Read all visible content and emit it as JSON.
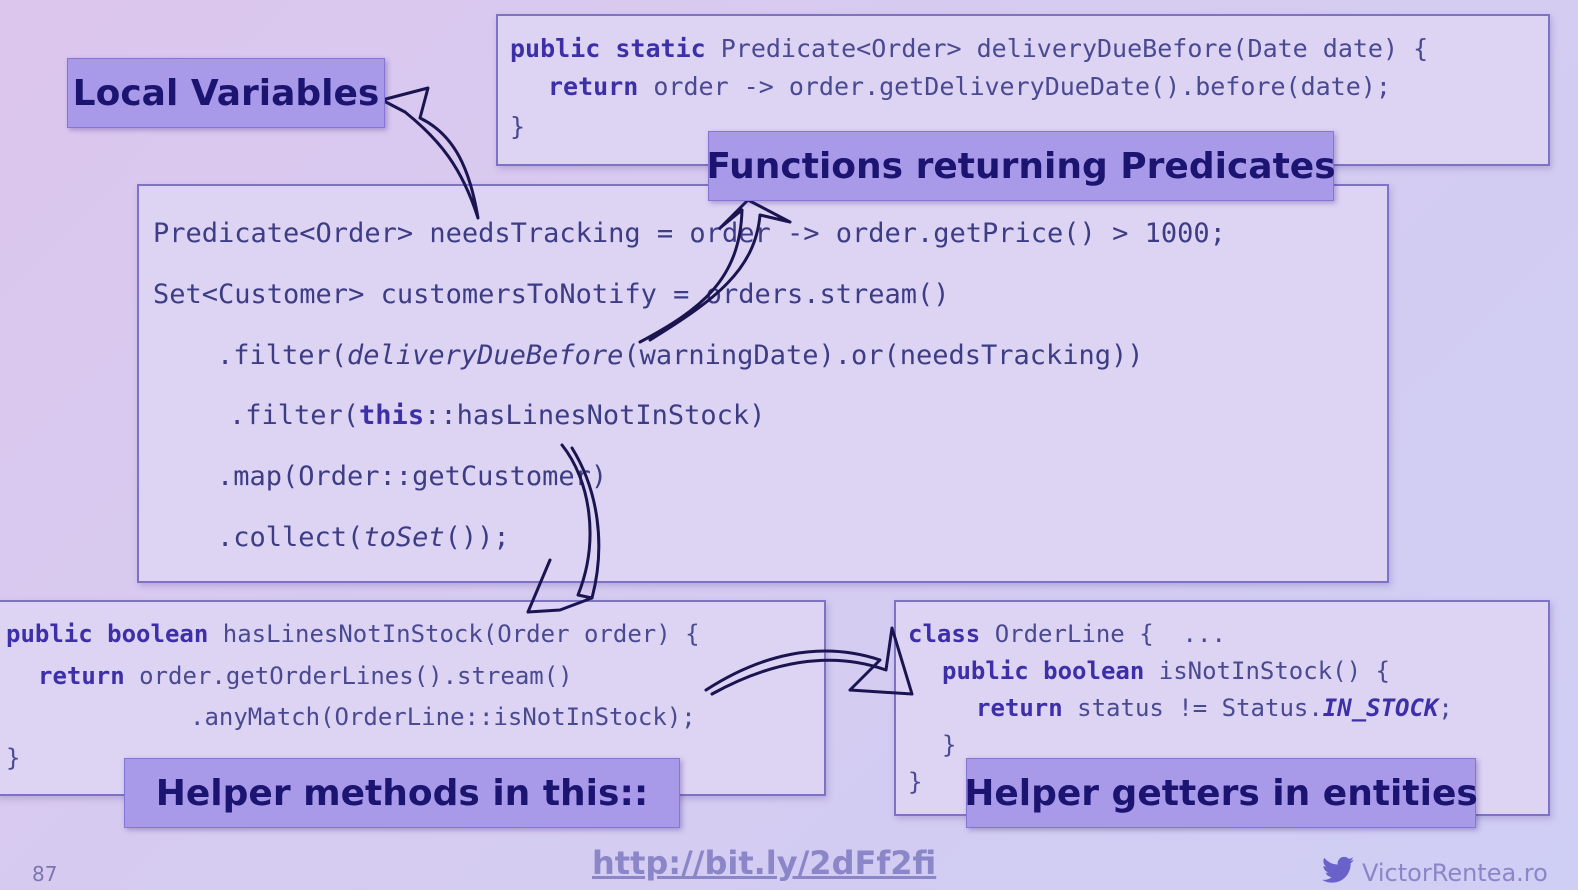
{
  "top_code": {
    "l1_kw": "public static",
    "l1_rest": " Predicate<Order> deliveryDueBefore(Date date) {",
    "l2_kw": "return",
    "l2_rest": " order -> order.getDeliveryDueDate().before(date);",
    "l3": "}"
  },
  "main_code": {
    "l1": "Predicate<Order> needsTracking = order -> order.getPrice() > 1000;",
    "l2": "Set<Customer> customersToNotify = orders.stream()",
    "l3_a": ".filter(",
    "l3_b": "deliveryDueBefore",
    "l3_c": "(warningDate).or(needsTracking))",
    "l4_a": ".filter(",
    "l4_b": "this",
    "l4_c": "::hasLinesNotInStock)",
    "l5": ".map(Order::getCustomer)",
    "l6_a": ".collect(",
    "l6_b": "toSet",
    "l6_c": "());"
  },
  "helper_code": {
    "l1_kw": "public boolean",
    "l1_rest": " hasLinesNotInStock(Order order) {",
    "l2_kw": "return",
    "l2_rest": " order.getOrderLines().stream()",
    "l3": ".anyMatch(OrderLine::isNotInStock);",
    "l4": "}"
  },
  "entity_code": {
    "l1_kw": "class",
    "l1_rest": " OrderLine {  ...",
    "l2_kw": "public boolean",
    "l2_rest": " isNotInStock() {",
    "l3_kw": "return",
    "l3_rest": " status != Status.",
    "l3_it": "IN_STOCK",
    "l3_end": ";",
    "l4": "}",
    "l5": "}"
  },
  "labels": {
    "local_variables": "Local Variables",
    "functions_returning_predicates": "Functions returning Predicates",
    "helper_methods": "Helper methods in this::",
    "helper_getters": "Helper getters in entities"
  },
  "footer": {
    "slide_number": "87",
    "url": "http://bit.ly/2dFf2fi",
    "twitter_handle": "VictorRentea.ro"
  },
  "colors": {
    "label_bg": "#a89ae8",
    "label_text": "#1b1470",
    "code_text": "#4a4a92",
    "keyword": "#3c2fa8",
    "url": "#8a86c8"
  },
  "icons": [
    "twitter-bird-icon"
  ]
}
